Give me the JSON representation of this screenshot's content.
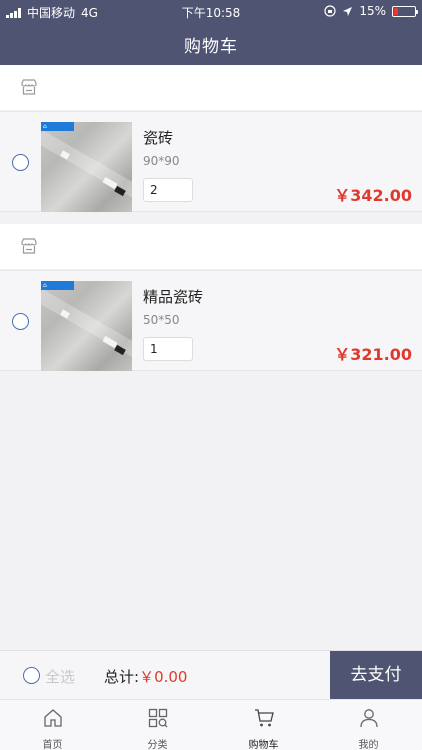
{
  "status_bar": {
    "carrier": "中国移动",
    "network": "4G",
    "time": "下午10:58",
    "battery": "15%"
  },
  "nav": {
    "title": "购物车"
  },
  "cart": {
    "shops": [
      {
        "items": [
          {
            "name": "瓷砖",
            "spec": "90*90",
            "quantity": "2",
            "price": "￥342.00"
          }
        ]
      },
      {
        "items": [
          {
            "name": "精品瓷砖",
            "spec": "50*50",
            "quantity": "1",
            "price": "￥321.00"
          }
        ]
      }
    ]
  },
  "checkout": {
    "select_all_label": "全选",
    "total_label": "总计:",
    "total_value": "￥0.00",
    "pay_button": "去支付"
  },
  "tabbar": {
    "tabs": [
      {
        "label": "首页",
        "icon": "home-icon"
      },
      {
        "label": "分类",
        "icon": "category-icon"
      },
      {
        "label": "购物车",
        "icon": "cart-icon"
      },
      {
        "label": "我的",
        "icon": "profile-icon"
      }
    ]
  }
}
